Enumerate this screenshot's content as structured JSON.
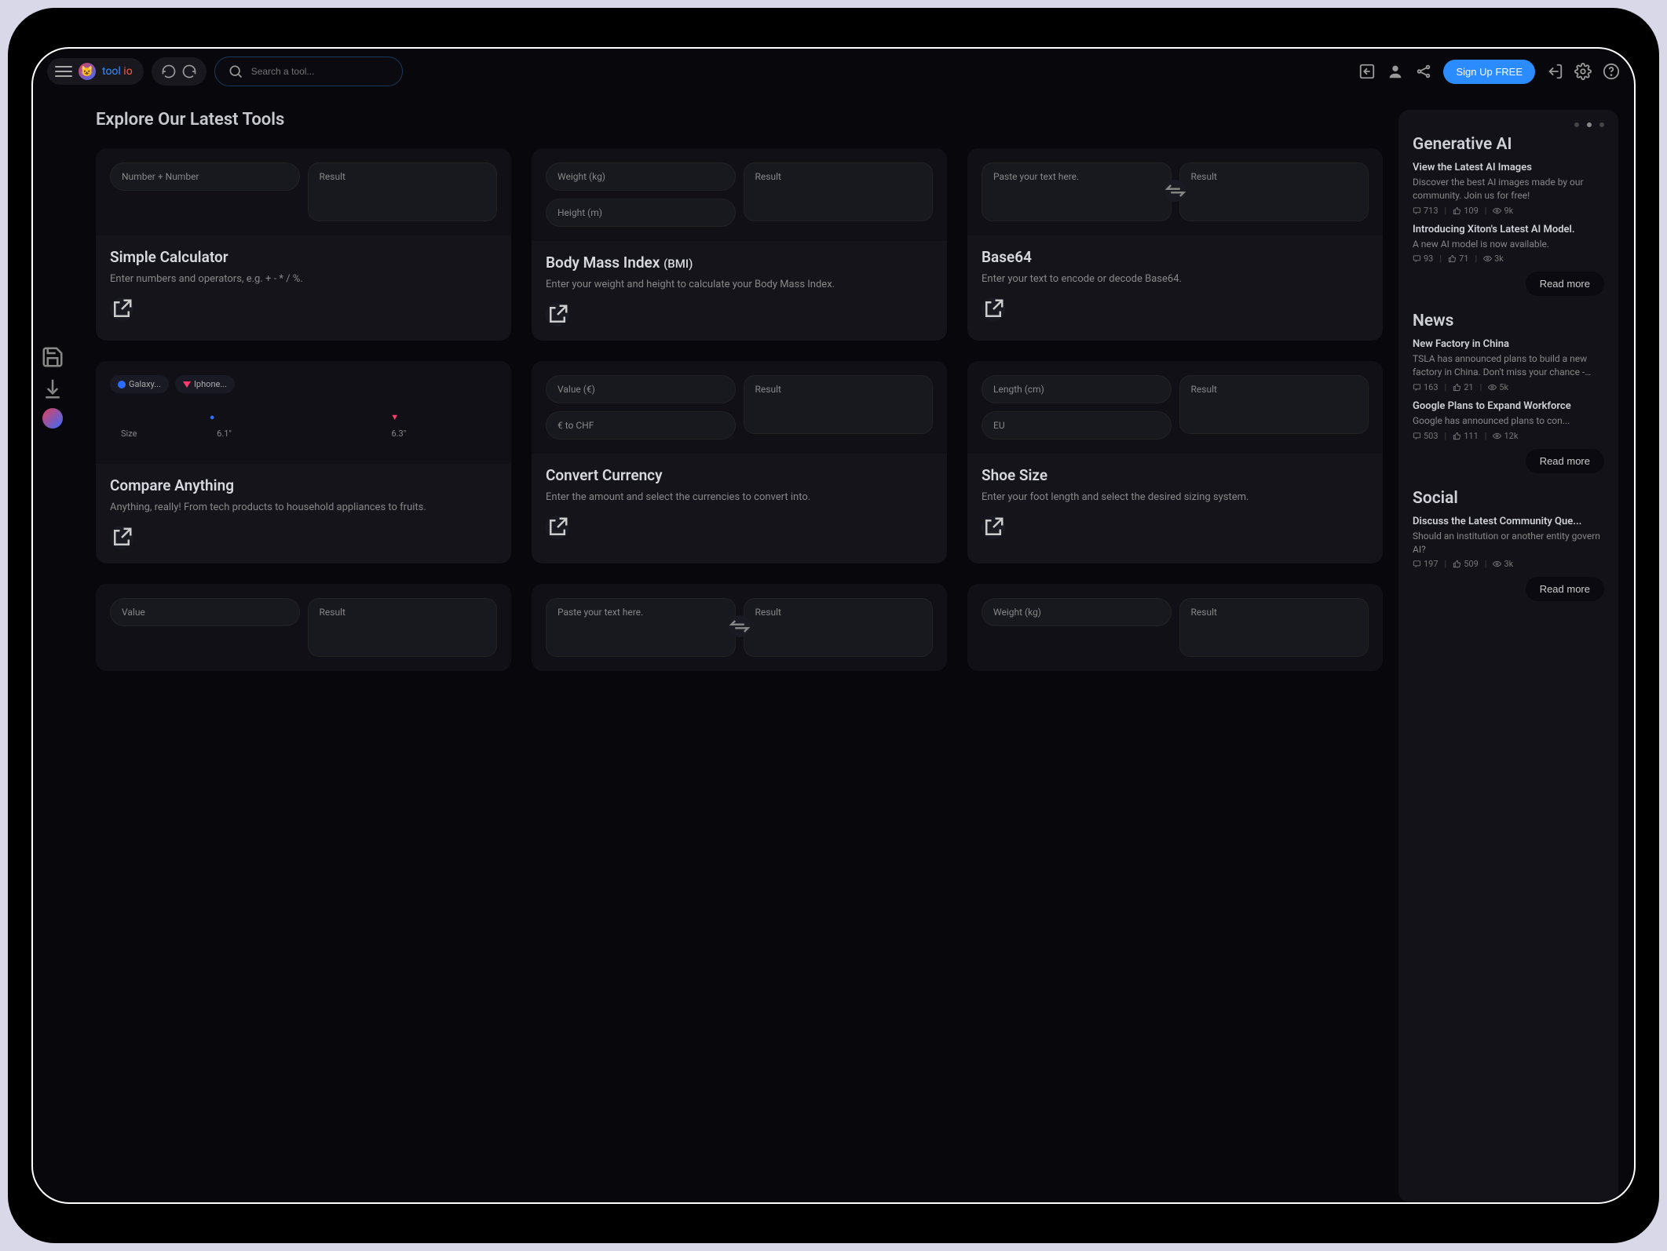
{
  "brand": {
    "tool": "tool",
    "io": " io"
  },
  "search": {
    "placeholder": "Search a tool..."
  },
  "cta": {
    "signup": "Sign Up FREE"
  },
  "section_title": "Explore Our Latest Tools",
  "tools": [
    {
      "title": "Simple Calculator",
      "desc": "Enter numbers and operators, e.g. + - * / %.",
      "preview": {
        "type": "two_col",
        "left": "Number + Number",
        "right": "Result"
      }
    },
    {
      "title": "Body Mass Index",
      "title_sub": "(BMI)",
      "desc": "Enter your weight and height to calculate your Body Mass Index.",
      "preview": {
        "type": "stacked_right",
        "l1": "Weight (kg)",
        "l2": "Height (m)",
        "right": "Result"
      }
    },
    {
      "title": "Base64",
      "desc": "Enter your text to encode or decode Base64.",
      "preview": {
        "type": "swap",
        "left": "Paste your text here.",
        "right": "Result"
      }
    },
    {
      "title": "Compare Anything",
      "desc": "Anything, really! From tech products to household appliances to fruits.",
      "preview": {
        "type": "compare",
        "chip1": "Galaxy...",
        "chip2": "Iphone...",
        "row_label": "Size",
        "v1": "6.1\"",
        "v2": "6.3\""
      }
    },
    {
      "title": "Convert Currency",
      "desc": "Enter the amount and select the currencies to convert into.",
      "preview": {
        "type": "stacked_right",
        "l1": "Value (€)",
        "l2": "€ to CHF",
        "right": "Result"
      }
    },
    {
      "title": "Shoe Size",
      "desc": "Enter your foot length and select the desired sizing system.",
      "preview": {
        "type": "stacked_right",
        "l1": "Length (cm)",
        "l2": "EU",
        "right": "Result"
      }
    },
    {
      "title": "",
      "desc": "",
      "preview": {
        "type": "two_col",
        "left": "Value",
        "right": "Result"
      }
    },
    {
      "title": "",
      "desc": "",
      "preview": {
        "type": "swap",
        "left": "Paste your text here.",
        "right": "Result"
      }
    },
    {
      "title": "",
      "desc": "",
      "preview": {
        "type": "stacked_right",
        "l1": "Weight (kg)",
        "l2": "",
        "right": "Result"
      }
    }
  ],
  "sidebar": {
    "sections": [
      {
        "heading": "Generative AI",
        "items": [
          {
            "title": "View the Latest AI Images",
            "desc": "Discover the best AI images made by our community. Join us for free!",
            "comments": "713",
            "likes": "109",
            "views": "9k"
          },
          {
            "title": "Introducing Xiton's Latest AI Model.",
            "desc": "A new AI model is now available.",
            "comments": "93",
            "likes": "71",
            "views": "3k"
          }
        ]
      },
      {
        "heading": "News",
        "items": [
          {
            "title": "New Factory in China",
            "desc": "TSLA has announced plans to build a new factory in China. Don't miss your chance - apply today!",
            "comments": "163",
            "likes": "21",
            "views": "5k"
          },
          {
            "title": "Google Plans to Expand Workforce",
            "desc": "Google has announced plans to con...",
            "comments": "503",
            "likes": "111",
            "views": "12k"
          }
        ]
      },
      {
        "heading": "Social",
        "items": [
          {
            "title": "Discuss the Latest Community Que...",
            "desc": "Should an institution or another entity govern AI?",
            "comments": "197",
            "likes": "509",
            "views": "3k"
          }
        ]
      }
    ],
    "read_more": "Read more"
  }
}
